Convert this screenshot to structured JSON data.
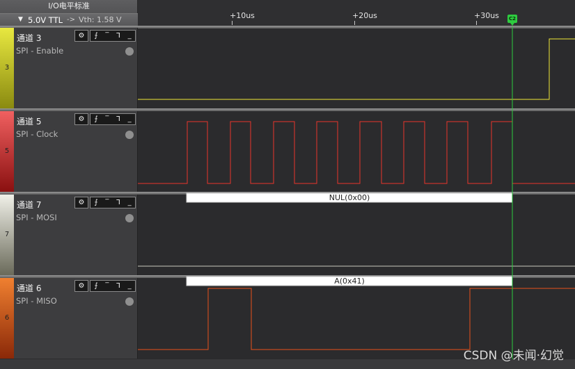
{
  "header": {
    "io_title": "I/O电平标准",
    "io_level": "5.0V TTL",
    "arrow": "->",
    "vth": "Vth: 1.58 V"
  },
  "ruler": {
    "ticks": [
      "+10us",
      "+20us",
      "+30us"
    ],
    "marker": "C2"
  },
  "channels": [
    {
      "index": "3",
      "name": "通道 3",
      "analyzer": "SPI - Enable",
      "color": "#f0e838",
      "strip_colors": [
        "#e8e840",
        "#8a8a10"
      ]
    },
    {
      "index": "5",
      "name": "通道 5",
      "analyzer": "SPI - Clock",
      "color": "#e8342a",
      "strip_colors": [
        "#f06060",
        "#8a1010"
      ]
    },
    {
      "index": "7",
      "name": "通道 7",
      "analyzer": "SPI - MOSI",
      "color": "#c8c8c0",
      "strip_colors": [
        "#f0f0e8",
        "#6a6a5a"
      ]
    },
    {
      "index": "6",
      "name": "通道 6",
      "analyzer": "SPI - MISO",
      "color": "#e8521a",
      "strip_colors": [
        "#f08030",
        "#8a2808"
      ]
    }
  ],
  "channel_buttons": {
    "gear": "⚙",
    "rise": "⨍",
    "high": "‾",
    "fall": "Ꞁ",
    "low": "_"
  },
  "decodes": {
    "mosi": "NUL(0x00)",
    "miso": "A(0x41)"
  },
  "watermark": "CSDN @未闻·幻觉"
}
